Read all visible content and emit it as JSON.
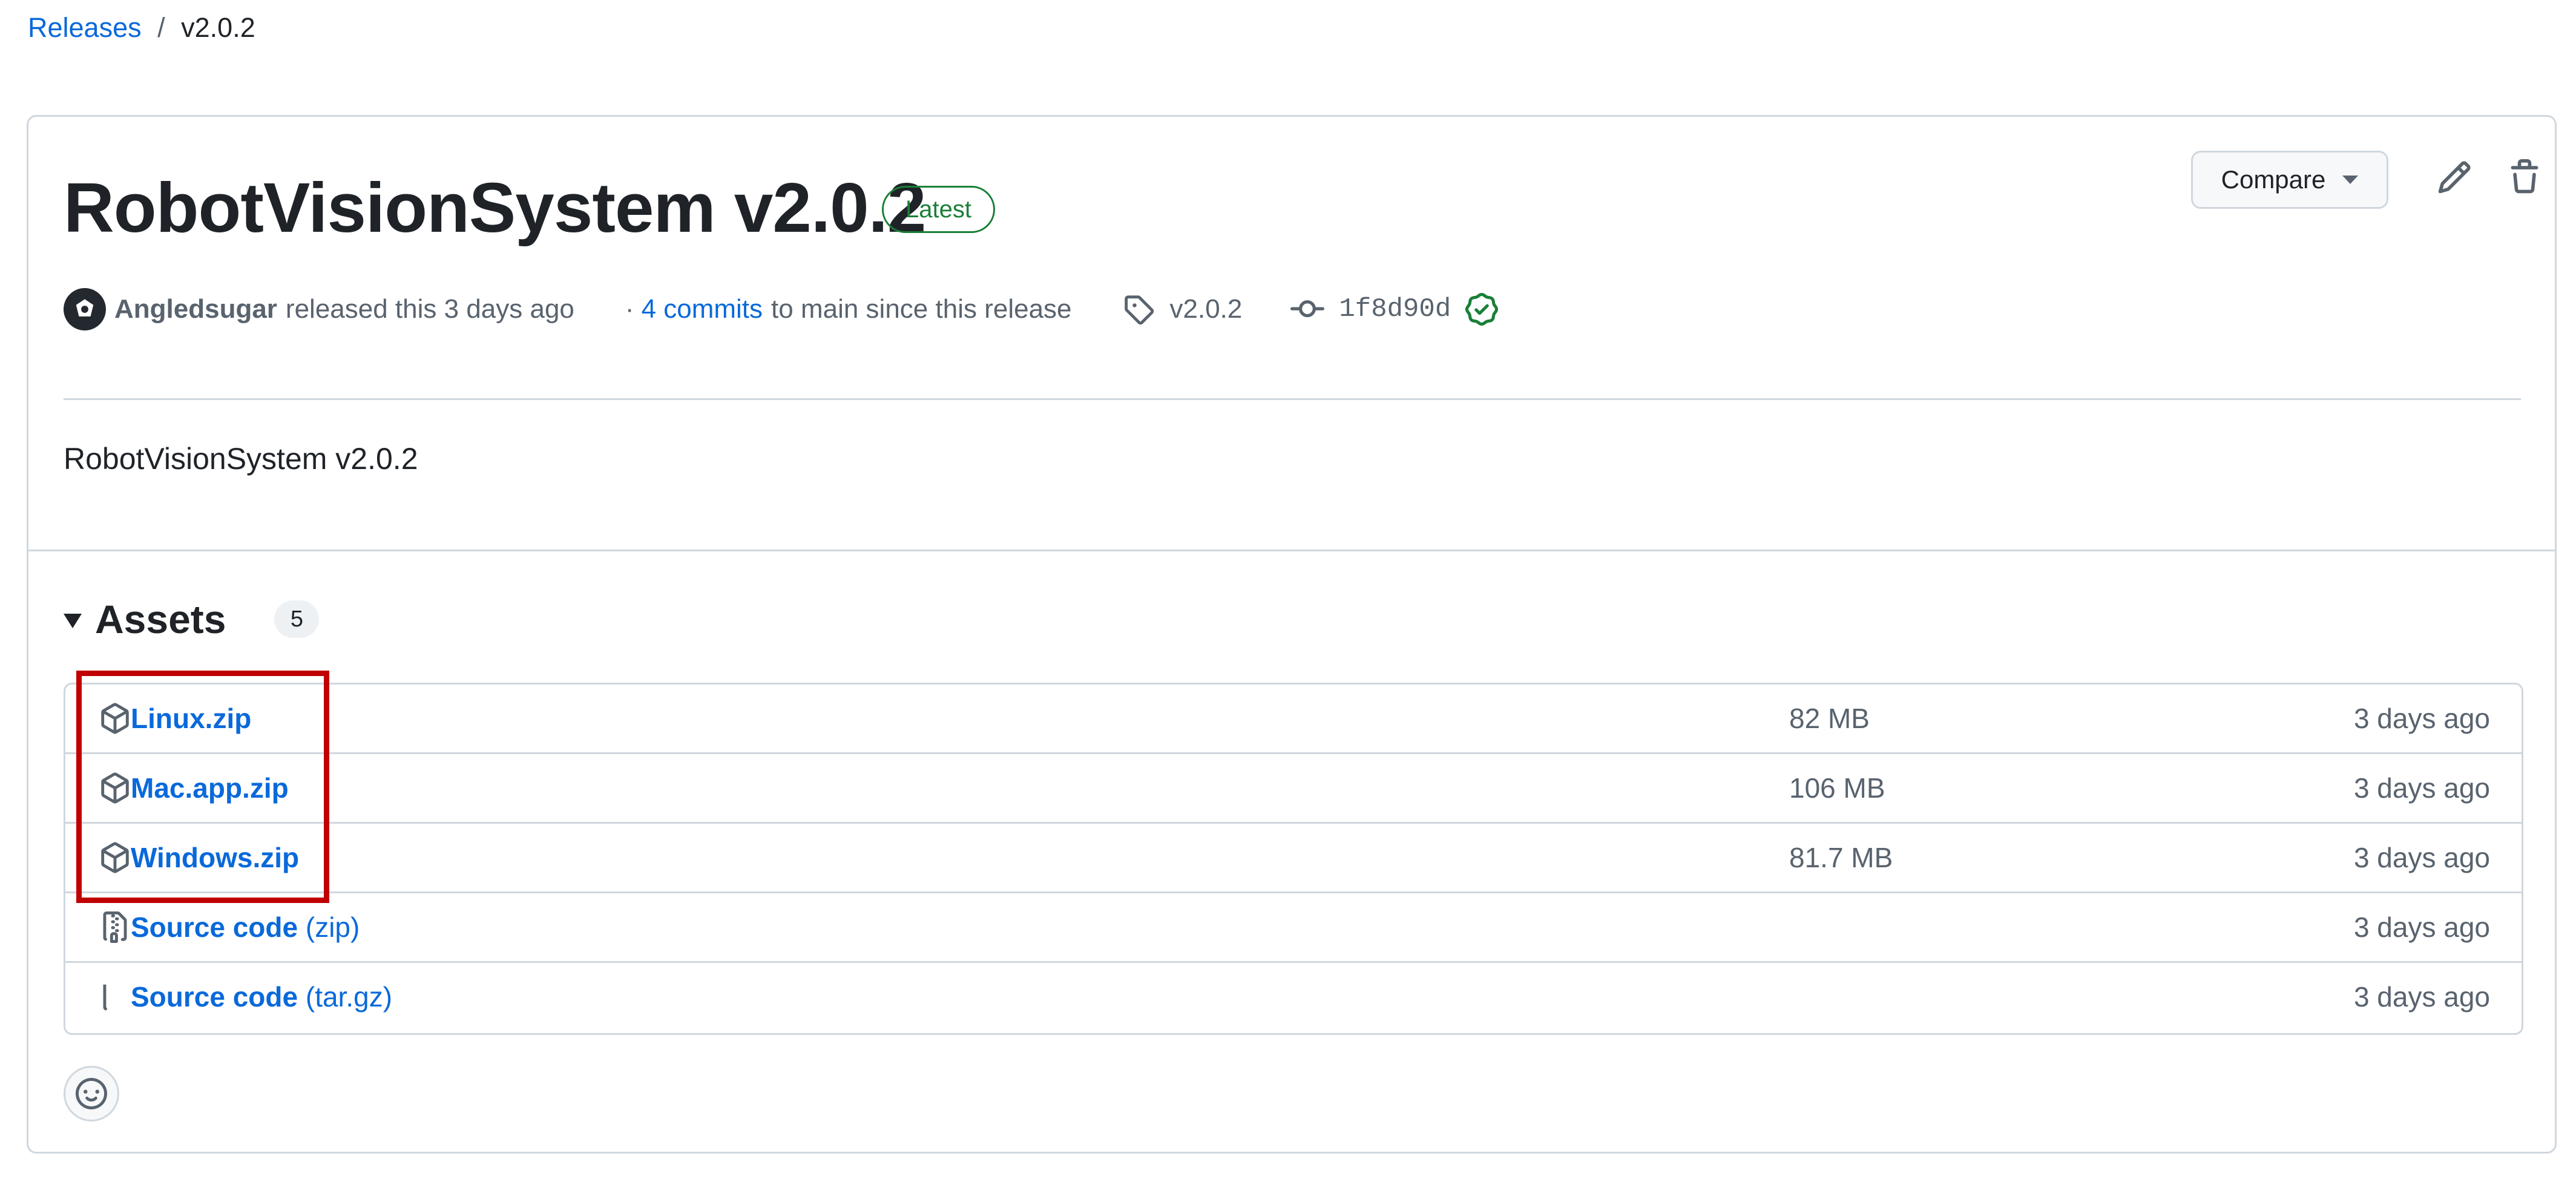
{
  "breadcrumb": {
    "releases_link": "Releases",
    "separator": "/",
    "current": "v2.0.2"
  },
  "release": {
    "title": "RobotVisionSystem v2.0.2",
    "latest_badge": "Latest",
    "author": "Angledsugar",
    "released_text": "released this 3 days ago",
    "commits_prefix": "·",
    "commits_link": "4 commits",
    "commits_suffix": "to main since this release",
    "tag": "v2.0.2",
    "commit_hash": "1f8d90d",
    "body": "RobotVisionSystem v2.0.2"
  },
  "toolbar": {
    "compare_label": "Compare",
    "edit_icon": "pencil-icon",
    "delete_icon": "trash-icon"
  },
  "assets": {
    "title": "Assets",
    "count": "5",
    "rows": [
      {
        "name": "Linux.zip",
        "suffix": "",
        "size": "82 MB",
        "date": "3 days ago",
        "icon": "package-icon"
      },
      {
        "name": "Mac.app.zip",
        "suffix": "",
        "size": "106 MB",
        "date": "3 days ago",
        "icon": "package-icon"
      },
      {
        "name": "Windows.zip",
        "suffix": "",
        "size": "81.7 MB",
        "date": "3 days ago",
        "icon": "package-icon"
      },
      {
        "name": "Source code",
        "suffix": "(zip)",
        "size": "",
        "date": "3 days ago",
        "icon": "file-zip-icon"
      },
      {
        "name": "Source code",
        "suffix": "(tar.gz)",
        "size": "",
        "date": "3 days ago",
        "icon": "file-zip-icon"
      }
    ]
  },
  "colors": {
    "link": "#0969da",
    "latest_green": "#1a7f37",
    "highlight_red": "#c00000",
    "border": "#d0d7de"
  }
}
